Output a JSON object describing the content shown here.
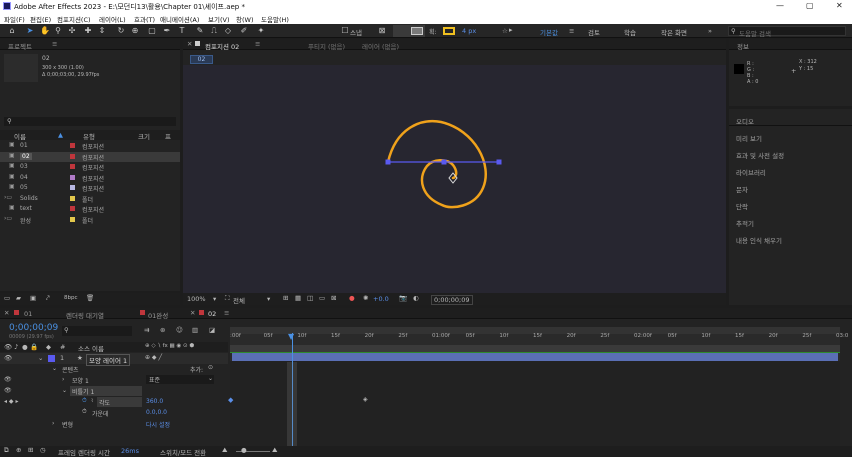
{
  "window": {
    "title": "Adobe After Effects 2023 - E:\\모던디13\\활용\\Chapter 01\\셰이프.aep *"
  },
  "menu": [
    "파일(F)",
    "편집(E)",
    "컴포지션(C)",
    "레이어(L)",
    "효과(T)",
    "애니메이션(A)",
    "보기(V)",
    "창(W)",
    "도움말(H)"
  ],
  "toolbar": {
    "snap_label": "스냅",
    "stroke_width": "4 px",
    "stroke_label": "획:",
    "workspaces": [
      "기본값",
      "검토",
      "학습",
      "작은 화면"
    ],
    "search_placeholder": "도움말 검색"
  },
  "project": {
    "tab": "프로젝트",
    "selected": {
      "name": "02",
      "info1": "300 x 300 (1.00)",
      "info2": "Δ 0;00;03;00, 29.97fps"
    },
    "search_placeholder": "",
    "columns": {
      "name": "이름",
      "type": "유형",
      "size": "크기",
      "fps": "프"
    },
    "items": [
      {
        "name": "01",
        "type": "컴포지션",
        "color": "#c0363c"
      },
      {
        "name": "02",
        "type": "컴포지션",
        "color": "#c0363c"
      },
      {
        "name": "03",
        "type": "컴포지션",
        "color": "#c0363c"
      },
      {
        "name": "04",
        "type": "컴포지션",
        "color": "#b07ac8"
      },
      {
        "name": "05",
        "type": "컴포지션",
        "color": "#b7b7e3"
      },
      {
        "name": "Solids",
        "type": "폴더",
        "color": "#e3c84c"
      },
      {
        "name": "text",
        "type": "컴포지션",
        "color": "#c0363c"
      },
      {
        "name": "완성",
        "type": "폴더",
        "color": "#e3c84c"
      }
    ],
    "bpc": "8bpc"
  },
  "viewer": {
    "tabs": [
      "컴포지션 02",
      "푸티지 (없음)",
      "레이어 (없음)"
    ],
    "breadcrumb": "02",
    "zoom": "100%",
    "resolution": "전체",
    "exposure": "+0.0",
    "timecode": "0;00;00;09"
  },
  "info": {
    "title": "정보",
    "rgb": [
      "R :",
      "G :",
      "B :",
      "A : 0"
    ],
    "coords": [
      "X : 312",
      "Y : 15"
    ]
  },
  "right_panels": [
    "오디오",
    "미리 보기",
    "효과 및 사전 설정",
    "라이브러리",
    "문자",
    "단락",
    "추적기",
    "내용 인식 채우기"
  ],
  "timeline": {
    "tabs": [
      "01",
      "렌더링 대기열",
      "01완성",
      "02"
    ],
    "timecode": "0;00;00;09",
    "timecode_sub": "00009 (29.97 fps)",
    "header": {
      "source_name": "소스 이름"
    },
    "ruler": [
      ":00f",
      "05f",
      "10f",
      "15f",
      "20f",
      "25f",
      "01:00f",
      "05f",
      "10f",
      "15f",
      "20f",
      "25f",
      "02:00f",
      "05f",
      "10f",
      "15f",
      "20f",
      "25f",
      "03:0"
    ],
    "layer": {
      "num": "1",
      "name": "모양 레이어 1"
    },
    "content_label": "콘텐츠",
    "add_label": "추가:",
    "shape1": "모양 1",
    "shape1_mode": "표준",
    "twist": "비틀기 1",
    "angle_label": "각도",
    "angle_value": "360.0",
    "center_label": "가운데",
    "center_value": "0.0,0.0",
    "transform_label": "변형",
    "reset_label": "다시 설정",
    "footer": {
      "render_label": "프레임 렌더링 시간",
      "render_value": "26ms",
      "toggle": "스위치/모드 전환"
    }
  },
  "colors": {
    "accent": "#4a90e2",
    "spiral": "#f0a21b",
    "path": "#5a5af0",
    "layer_bar": "#5a6fb5"
  }
}
